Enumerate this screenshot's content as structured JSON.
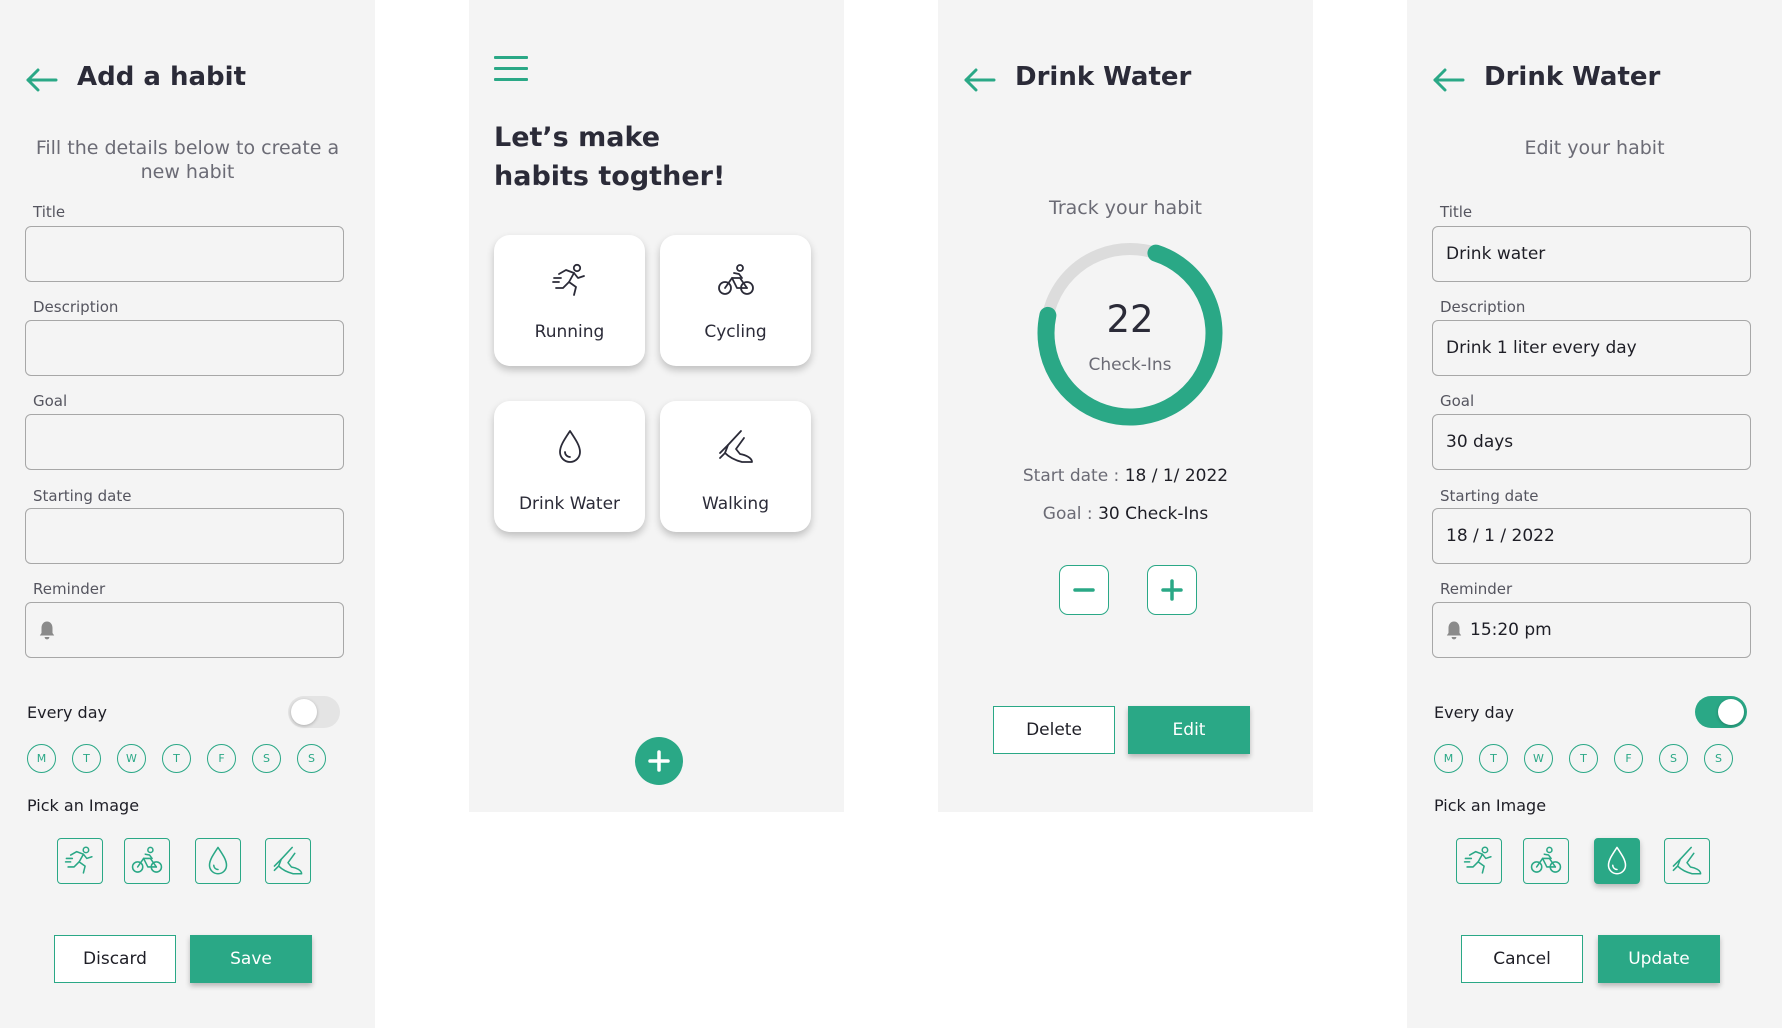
{
  "colors": {
    "accent": "#2aa886",
    "background": "#f4f4f4",
    "text": "#2b2b38",
    "muted": "#6b6b75"
  },
  "add_screen": {
    "title": "Add a habit",
    "subtitle": "Fill the details below to create a new habit",
    "fields": [
      {
        "label": "Title",
        "value": ""
      },
      {
        "label": "Description",
        "value": ""
      },
      {
        "label": "Goal",
        "value": ""
      },
      {
        "label": "Starting date",
        "value": ""
      },
      {
        "label": "Reminder",
        "value": "",
        "icon": "bell-icon"
      }
    ],
    "every_day_label": "Every day",
    "every_day_on": false,
    "days": [
      "M",
      "T",
      "W",
      "T",
      "F",
      "S",
      "S"
    ],
    "pick_image_label": "Pick an Image",
    "images": [
      "running-icon",
      "cycling-icon",
      "drop-icon",
      "walking-icon"
    ],
    "selected_image": null,
    "discard_label": "Discard",
    "save_label": "Save"
  },
  "home_screen": {
    "menu_icon": "hamburger-menu-icon",
    "heading_line1": "Let’s make",
    "heading_line2": "habits togther!",
    "habits": [
      {
        "label": "Running",
        "icon": "running-icon"
      },
      {
        "label": "Cycling",
        "icon": "cycling-icon"
      },
      {
        "label": "Drink Water",
        "icon": "drop-icon"
      },
      {
        "label": "Walking",
        "icon": "walking-icon"
      }
    ],
    "add_icon": "plus-icon"
  },
  "detail_screen": {
    "title": "Drink Water",
    "track_label": "Track your habit",
    "checkins": "22",
    "checkins_label": "Check-Ins",
    "progress": 0.7333,
    "start_date_label": "Start date :",
    "start_date_value": "18 / 1/ 2022",
    "goal_label": "Goal :",
    "goal_value": "30 Check-Ins",
    "delete_label": "Delete",
    "edit_label": "Edit"
  },
  "edit_screen": {
    "title": "Drink Water",
    "subtitle": "Edit your habit",
    "fields": [
      {
        "label": "Title",
        "value": "Drink water"
      },
      {
        "label": "Description",
        "value": "Drink 1 liter every day"
      },
      {
        "label": "Goal",
        "value": "30 days"
      },
      {
        "label": "Starting date",
        "value": "18 / 1 / 2022"
      },
      {
        "label": "Reminder",
        "value": "15:20 pm",
        "icon": "bell-icon"
      }
    ],
    "every_day_label": "Every day",
    "every_day_on": true,
    "days": [
      "M",
      "T",
      "W",
      "T",
      "F",
      "S",
      "S"
    ],
    "pick_image_label": "Pick an Image",
    "images": [
      "running-icon",
      "cycling-icon",
      "drop-icon",
      "walking-icon"
    ],
    "selected_image": "drop-icon",
    "cancel_label": "Cancel",
    "update_label": "Update"
  }
}
